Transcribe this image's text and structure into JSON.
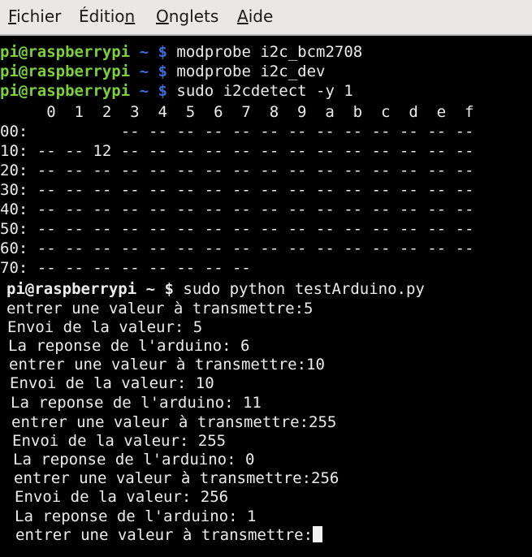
{
  "menubar": {
    "items": [
      {
        "first": "F",
        "rest": "ichier"
      },
      {
        "first": "",
        "pre": "Éditio",
        "u": "n",
        "rest": ""
      },
      {
        "first": "O",
        "rest": "nglets"
      },
      {
        "first": "A",
        "rest": "ide"
      }
    ]
  },
  "prompt": {
    "host": "pi@raspberrypi",
    "tilde": "~",
    "dollar": "$"
  },
  "commands": [
    "modprobe i2c_bcm2708",
    "modprobe i2c_dev",
    "sudo i2cdetect -y 1"
  ],
  "i2cdetect": {
    "header": "     0  1  2  3  4  5  6  7  8  9  a  b  c  d  e  f",
    "rows": [
      "00:          -- -- -- -- -- -- -- -- -- -- -- -- --",
      "10: -- -- 12 -- -- -- -- -- -- -- -- -- -- -- -- --",
      "20: -- -- -- -- -- -- -- -- -- -- -- -- -- -- -- --",
      "30: -- -- -- -- -- -- -- -- -- -- -- -- -- -- -- --",
      "40: -- -- -- -- -- -- -- -- -- -- -- -- -- -- -- --",
      "50: -- -- -- -- -- -- -- -- -- -- -- -- -- -- -- --",
      "60: -- -- -- -- -- -- -- -- -- -- -- -- -- -- -- --",
      "70: -- -- -- -- -- -- -- --"
    ]
  },
  "python_command": "sudo python testArduino.py",
  "output": [
    "entrer une valeur à transmettre:5",
    "Envoi de la valeur: 5",
    "La reponse de l'arduino: 6",
    "entrer une valeur à transmettre:10",
    "Envoi de la valeur: 10",
    "La reponse de l'arduino: 11",
    "entrer une valeur à transmettre:255",
    "Envoi de la valeur: 255",
    "La reponse de l'arduino: 0",
    "entrer une valeur à transmettre:256",
    "Envoi de la valeur: 256",
    "La reponse de l'arduino: 1"
  ],
  "last_prompt": "entrer une valeur à transmettre:",
  "colors": {
    "host": "#7bd03c",
    "path": "#3b6fd8",
    "text": "#ececec",
    "background": "#000000"
  }
}
